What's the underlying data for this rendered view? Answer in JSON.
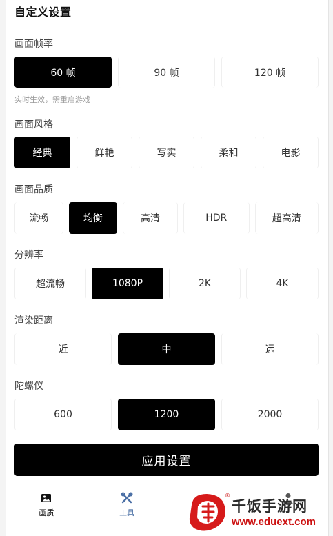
{
  "title": "自定义设置",
  "hint": "实时生效，需重启游戏",
  "sections": [
    {
      "label": "画面帧率",
      "options": [
        "60 帧",
        "90 帧",
        "120 帧"
      ],
      "selected": 0
    },
    {
      "label": "画面风格",
      "options": [
        "经典",
        "鲜艳",
        "写实",
        "柔和",
        "电影"
      ],
      "selected": 0
    },
    {
      "label": "画面品质",
      "options": [
        "流畅",
        "均衡",
        "高清",
        "HDR",
        "超高清"
      ],
      "selected": 1
    },
    {
      "label": "分辨率",
      "options": [
        "超流畅",
        "1080P",
        "2K",
        "4K"
      ],
      "selected": 1
    },
    {
      "label": "渲染距离",
      "options": [
        "近",
        "中",
        "远"
      ],
      "selected": 1
    },
    {
      "label": "陀螺仪",
      "options": [
        "600",
        "1200",
        "2000"
      ],
      "selected": 1
    }
  ],
  "apply_label": "应用设置",
  "tabs": [
    {
      "label": "画质",
      "icon": "image-icon"
    },
    {
      "label": "工具",
      "icon": "tools-icon"
    },
    {
      "label": "",
      "icon": ""
    },
    {
      "label": "",
      "icon": "user-icon"
    }
  ],
  "watermark": {
    "name": "千饭手游网",
    "url": "www.eduext.com"
  }
}
